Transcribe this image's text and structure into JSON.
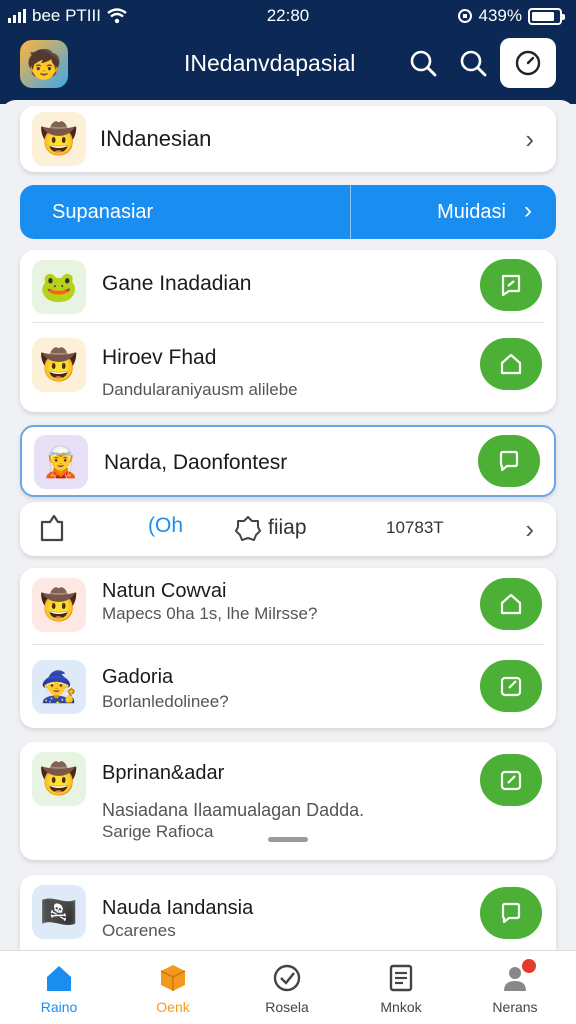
{
  "status": {
    "carrier": "bee PTIII",
    "time": "22:80",
    "battery": "439%",
    "battery_level": 0.85
  },
  "header": {
    "title": "INedanvdapasial"
  },
  "top_card": {
    "title": "INdanesian"
  },
  "segment": {
    "left_label": "Supanasiar",
    "right_label": "Muidasi"
  },
  "group1": [
    {
      "title": "Gane Inadadian",
      "subtitle": "",
      "avatar": "🐸"
    },
    {
      "title": "Hiroev Fhad",
      "subtitle": "Dandularaniyausm alilebe",
      "avatar": "🤠"
    }
  ],
  "highlighted": {
    "title": "Narda, Daonfontesr",
    "avatar": "🧝"
  },
  "filters": {
    "item2": "(Oh",
    "item3": "fiiap",
    "item4": "10783T"
  },
  "group2": [
    {
      "title": "Natun Cowvai",
      "subtitle": "Mapecs 0ha 1s, lhe Milrsse?",
      "avatar": "🤠"
    },
    {
      "title": "Gadoria",
      "subtitle": "Borlanledolinee?",
      "avatar": "🧙"
    }
  ],
  "card3": {
    "title": "Bprinan&adar",
    "line1": "Nasiadana Ilaamualagan Dadda.",
    "line2": "Sarige Rafioca",
    "avatar": "🤠"
  },
  "card4": {
    "title": "Nauda Iandansia",
    "subtitle": "Ocarenes",
    "avatar": "🏴‍☠️"
  },
  "tabs": [
    {
      "label": "Raino",
      "icon": "home-icon",
      "color": "#1a8ef0"
    },
    {
      "label": "Oenk",
      "icon": "box-icon",
      "color": "#f39a1e"
    },
    {
      "label": "Rosela",
      "icon": "check-shield-icon",
      "color": "#444444"
    },
    {
      "label": "Mnkok",
      "icon": "document-icon",
      "color": "#444444"
    },
    {
      "label": "Nerans",
      "icon": "profile-icon",
      "color": "#444444"
    }
  ],
  "colors": {
    "header_bg": "#0c2855",
    "accent_blue": "#1a8ef0",
    "accent_green": "#4caf36"
  }
}
